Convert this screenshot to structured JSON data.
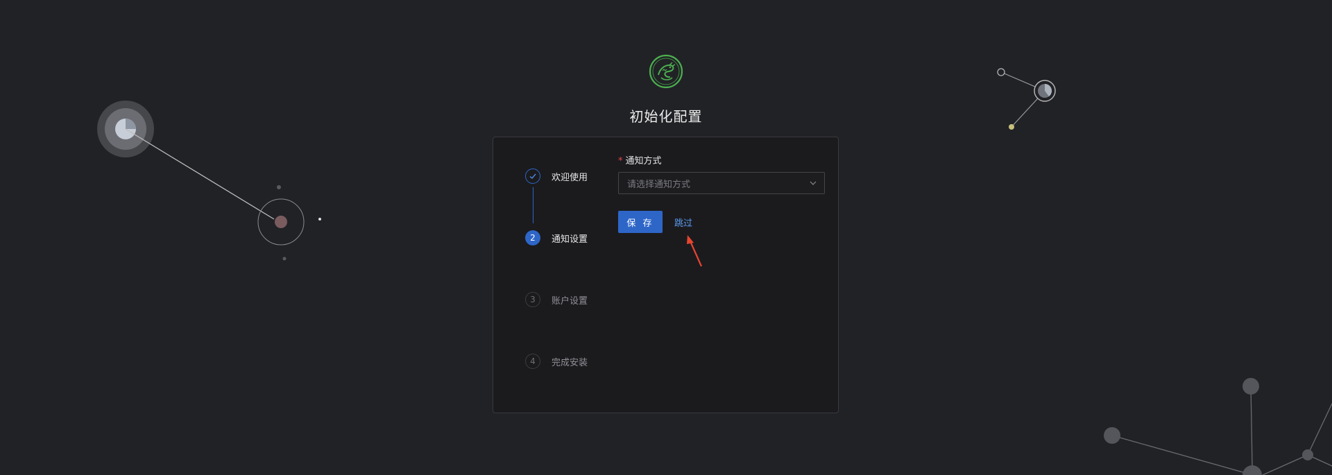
{
  "page": {
    "title": "初始化配置"
  },
  "steps": [
    {
      "number": "1",
      "label": "欢迎使用",
      "status": "done"
    },
    {
      "number": "2",
      "label": "通知设置",
      "status": "active"
    },
    {
      "number": "3",
      "label": "账户设置",
      "status": "waiting"
    },
    {
      "number": "4",
      "label": "完成安装",
      "status": "waiting"
    }
  ],
  "form": {
    "required_mark": "*",
    "notify_label": "通知方式",
    "notify_placeholder": "请选择通知方式",
    "save_label": "保 存",
    "skip_label": "跳过"
  },
  "colors": {
    "background": "#212226",
    "card": "#1b1b1e",
    "primary": "#2e66c8",
    "link": "#5b9bf0",
    "required": "#e5484d",
    "annotation_arrow": "#e8452f",
    "logo": "#4caf50"
  },
  "icons": {
    "logo": "dragon-emblem-icon",
    "step_done": "check-icon",
    "select": "chevron-down-icon",
    "annotation": "red-arrow-icon"
  }
}
